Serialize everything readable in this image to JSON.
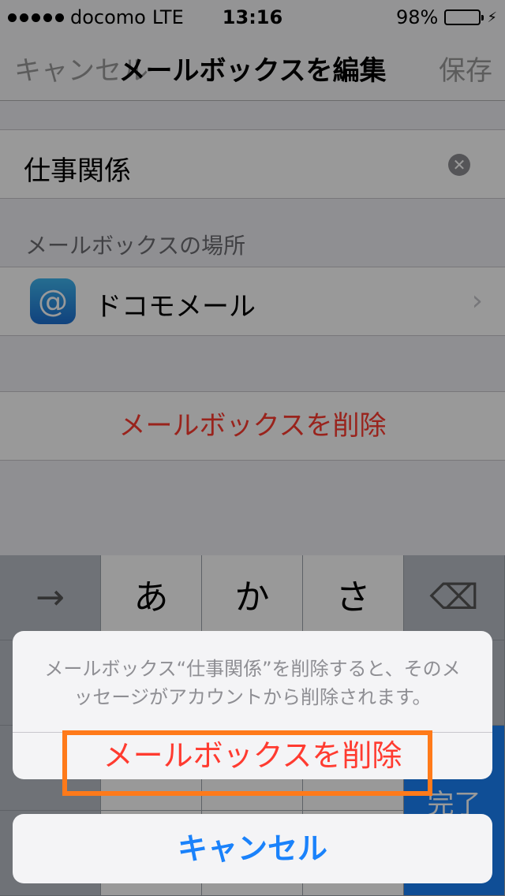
{
  "status_bar": {
    "carrier": "docomo",
    "network": "LTE",
    "time": "13:16",
    "battery": "98%",
    "battery_level": 0.98,
    "battery_color": "#4cd964"
  },
  "nav_bar": {
    "left_button": "キャンセル",
    "title": "メールボックスを編集",
    "right_button": "保存"
  },
  "name_field": {
    "value": "仕事関係",
    "clear_icon": "clear-circle-icon"
  },
  "location_section": {
    "header": "メールボックスの場所",
    "account": "ドコモメール",
    "account_icon": "at-sign-icon",
    "account_icon_glyph": "@"
  },
  "delete_row": {
    "label": "メールボックスを削除"
  },
  "keyboard": {
    "keys": [
      "→",
      "あ",
      "か",
      "さ"
    ],
    "delete_icon": "backspace-icon",
    "delete_glyph": "⌫",
    "done_partial": "完了"
  },
  "action_sheet": {
    "message_line1": "メールボックス“仕事関係”を削除すると、そのメ",
    "message_line2": "ッセージがアカウントから削除されます。",
    "destructive_button": "メールボックスを削除",
    "cancel_button": "キャンセル",
    "highlight_color": "#ff7a1a",
    "destructive_color": "#ff3b30",
    "cancel_color": "#1a82fb"
  }
}
